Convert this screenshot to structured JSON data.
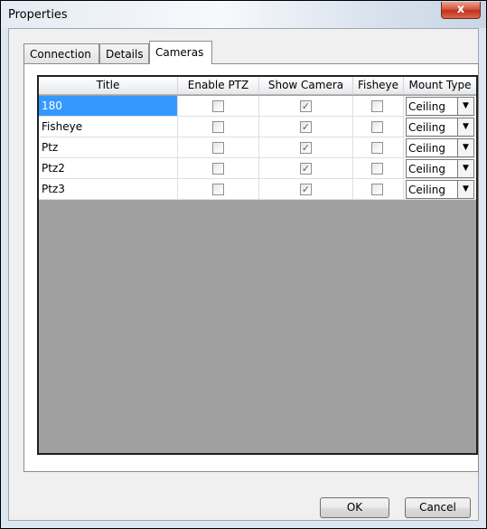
{
  "window": {
    "title": "Properties",
    "close_glyph": "x"
  },
  "tabs": [
    {
      "label": "Connection",
      "active": false
    },
    {
      "label": "Details",
      "active": false
    },
    {
      "label": "Cameras",
      "active": true
    }
  ],
  "grid": {
    "columns": [
      "Title",
      "Enable PTZ",
      "Show Camera",
      "Fisheye",
      "Mount Type"
    ],
    "rows": [
      {
        "title": "180",
        "enable_ptz": false,
        "show_camera": true,
        "fisheye": false,
        "mount_type": "Ceiling",
        "selected": true
      },
      {
        "title": "Fisheye",
        "enable_ptz": false,
        "show_camera": true,
        "fisheye": false,
        "mount_type": "Ceiling",
        "selected": false
      },
      {
        "title": "Ptz",
        "enable_ptz": false,
        "show_camera": true,
        "fisheye": false,
        "mount_type": "Ceiling",
        "selected": false
      },
      {
        "title": "Ptz2",
        "enable_ptz": false,
        "show_camera": true,
        "fisheye": false,
        "mount_type": "Ceiling",
        "selected": false
      },
      {
        "title": "Ptz3",
        "enable_ptz": false,
        "show_camera": true,
        "fisheye": false,
        "mount_type": "Ceiling",
        "selected": false
      }
    ]
  },
  "buttons": {
    "ok": "OK",
    "cancel": "Cancel"
  },
  "colors": {
    "selection": "#3399ff",
    "grid_background": "#a0a0a0"
  }
}
